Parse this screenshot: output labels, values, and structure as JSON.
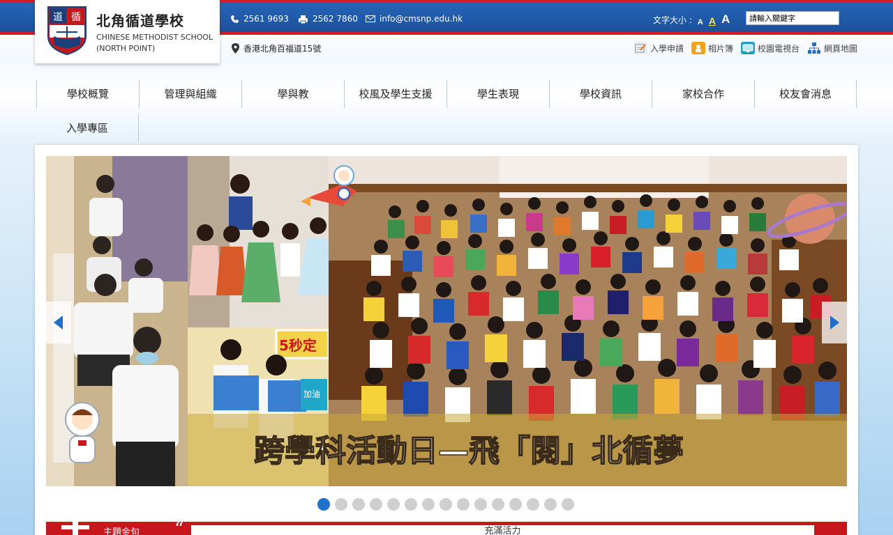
{
  "header": {
    "school_name_zh": "北角循道學校",
    "school_name_en_1": "CHINESE METHODIST SCHOOL",
    "school_name_en_2": "(NORTH POINT)",
    "crest_chars": [
      "道",
      "循"
    ],
    "phone": "2561 9693",
    "fax": "2562 7860",
    "email": "info@cmsnp.edu.hk",
    "address": "香港北角百福道15號",
    "font_size_label": "文字大小 :",
    "font_size_options": [
      "A",
      "A",
      "A"
    ],
    "search_placeholder": "請輸入關鍵字"
  },
  "quick_links": [
    {
      "label": "入學申請",
      "icon": "form-icon"
    },
    {
      "label": "相片簿",
      "icon": "photo-album-icon"
    },
    {
      "label": "校園電視台",
      "icon": "tv-icon"
    },
    {
      "label": "網頁地圖",
      "icon": "sitemap-icon"
    }
  ],
  "nav": {
    "items": [
      "學校概覽",
      "管理與組織",
      "學與教",
      "校風及學生支援",
      "學生表現",
      "學校資訊",
      "家校合作",
      "校友會消息",
      "入學專區"
    ]
  },
  "banner": {
    "caption": "跨學科活動日—飛「閱」北循夢",
    "sign_text": "5秒定",
    "book_text": "加油",
    "slide_count": 15,
    "active_slide": 1
  },
  "motto": {
    "title": "主題金句",
    "quote_mark": "“",
    "text": "充滿活力"
  },
  "colors": {
    "brand_blue": "#1f5aa8",
    "brand_red": "#d21c22",
    "dot_active": "#1f72c9"
  }
}
